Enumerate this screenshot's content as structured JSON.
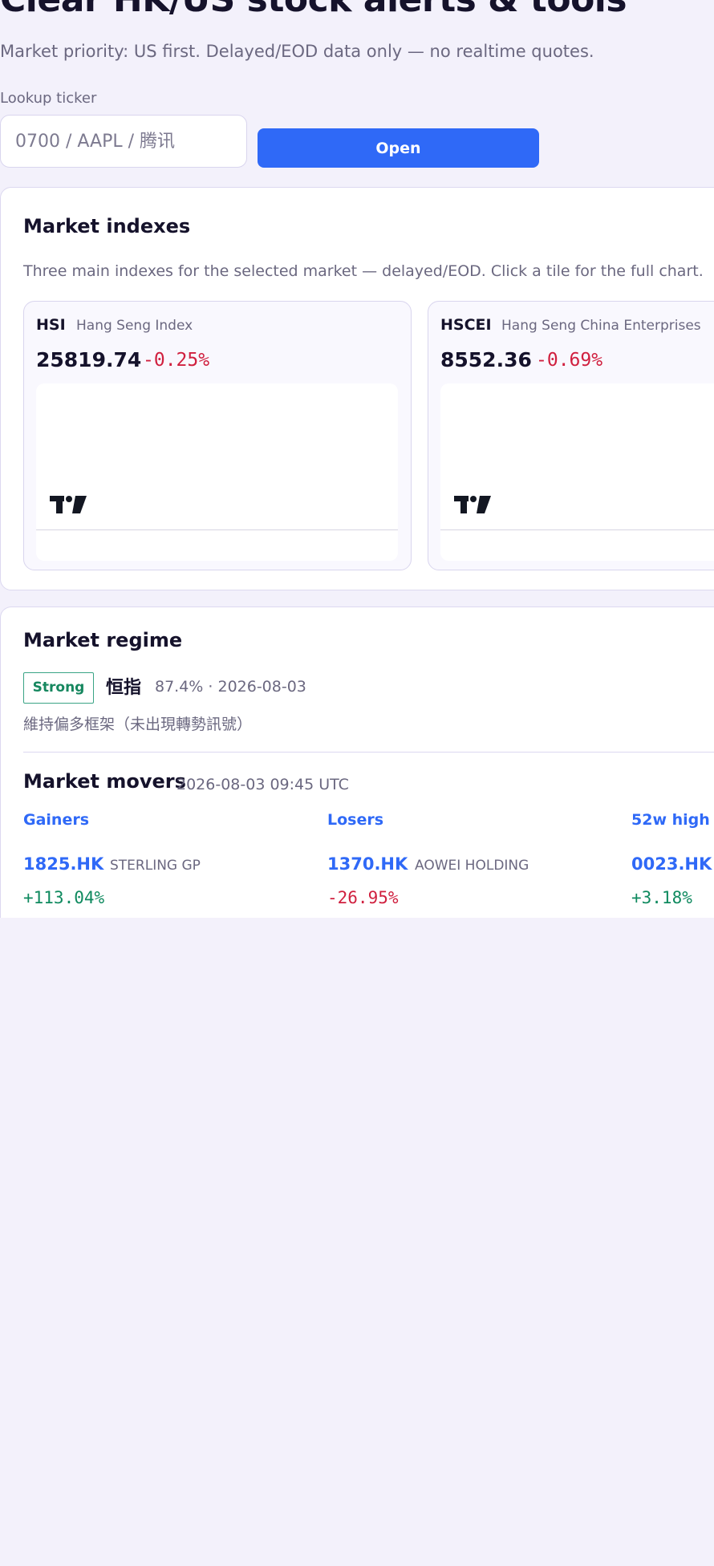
{
  "hero": {
    "title": "Clear HK/US stock alerts & tools",
    "subtitle": "Market priority: US first. Delayed/EOD data only — no realtime quotes."
  },
  "lookup": {
    "label": "Lookup ticker",
    "placeholder": "0700 / AAPL / 腾讯",
    "button_label": "Open"
  },
  "indexes": {
    "title": "Market indexes",
    "description": "Three main indexes for the selected market — delayed/EOD. Click a tile for the full chart.",
    "tiles": [
      {
        "symbol": "HSI",
        "name": "Hang Seng Index",
        "value": "25819.74",
        "change": "-0.25%"
      },
      {
        "symbol": "HSCEI",
        "name": "Hang Seng China Enterprises",
        "value": "8552.36",
        "change": "-0.69%"
      }
    ]
  },
  "regime": {
    "title": "Market regime",
    "badge": "Strong",
    "index_name": "恒指",
    "meta": "87.4% · 2026-08-03",
    "note": "維持偏多框架（未出現轉勢訊號）"
  },
  "movers": {
    "title": "Market movers",
    "timestamp": "2026-08-03 09:45 UTC",
    "columns": [
      {
        "heading": "Gainers",
        "ticker": "1825.HK",
        "name": "STERLING GP",
        "change": "+113.04%"
      },
      {
        "heading": "Losers",
        "ticker": "1370.HK",
        "name": "AOWEI HOLDING",
        "change": "-26.95%"
      },
      {
        "heading": "52w high",
        "ticker": "0023.HK",
        "name": "",
        "change": "+3.18%"
      }
    ]
  },
  "colors": {
    "accent": "#2f69f7",
    "positive": "#0f8a5f",
    "negative": "#d0203f",
    "background": "#f3f1fb"
  }
}
